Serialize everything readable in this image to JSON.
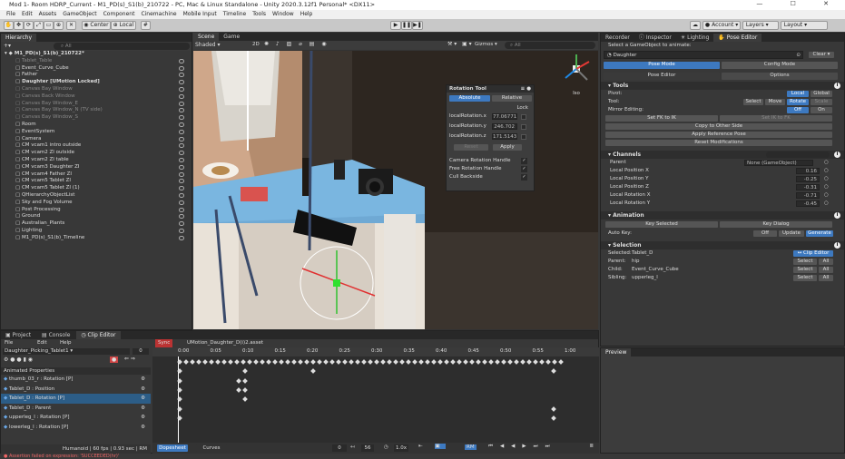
{
  "window": {
    "title": "Mod 1- Room HDRP_Current - M1_PD(s)_S1(b)_210722 - PC, Mac & Linux Standalone - Unity 2020.3.12f1 Personal* <DX11>",
    "controls": "—  ☐  ✕"
  },
  "menu": [
    "File",
    "Edit",
    "Assets",
    "GameObject",
    "Component",
    "Cinemachine",
    "Mobile Input",
    "Timeline",
    "Tools",
    "Window",
    "Help"
  ],
  "toolbar": {
    "pivot": "Center",
    "space": "Local",
    "account": "Account",
    "layers": "Layers",
    "layout": "Layout"
  },
  "hierarchy": {
    "tab": "Hierarchy",
    "search": "All",
    "root": "M1_PD(s)_S1(b)_210722*",
    "items": [
      {
        "label": "Tablet_Table",
        "depth": 1,
        "dim": true
      },
      {
        "label": "Event_Curve_Cube",
        "depth": 1
      },
      {
        "label": "Father",
        "depth": 1
      },
      {
        "label": "Daughter [UMotion Locked]",
        "depth": 1,
        "bold": true
      },
      {
        "label": "Canvas Bay Window",
        "depth": 1,
        "dim": true
      },
      {
        "label": "Canvas Back Window",
        "depth": 1,
        "dim": true
      },
      {
        "label": "Canvas Bay Window_E",
        "depth": 1,
        "dim": true
      },
      {
        "label": "Canvas Bay Window_N  (TV side)",
        "depth": 1,
        "dim": true
      },
      {
        "label": "Canvas Bay Window_S",
        "depth": 1,
        "dim": true
      },
      {
        "label": "Room",
        "depth": 1
      },
      {
        "label": "EventSystem",
        "depth": 1
      },
      {
        "label": "Camera",
        "depth": 1
      },
      {
        "label": "CM vcam1 intro outside",
        "depth": 1
      },
      {
        "label": "CM vcam2 ZI outside",
        "depth": 1
      },
      {
        "label": "CM vcam2 ZI table",
        "depth": 1
      },
      {
        "label": "CM vcam3 Daughter ZI",
        "depth": 1
      },
      {
        "label": "CM vcam4 Father ZI",
        "depth": 1
      },
      {
        "label": "CM vcam5 Tablet ZI",
        "depth": 1
      },
      {
        "label": "CM vcam5 Tablet ZI (1)",
        "depth": 1
      },
      {
        "label": "QHierarchyObjectList",
        "depth": 1
      },
      {
        "label": "Sky and Fog Volume",
        "depth": 1
      },
      {
        "label": "Post Processing",
        "depth": 1
      },
      {
        "label": "Ground",
        "depth": 1
      },
      {
        "label": "Australian_Plants",
        "depth": 1
      },
      {
        "label": "Lighting",
        "depth": 1
      },
      {
        "label": "M1_PD(s)_S1(b)_Timeline",
        "depth": 1
      }
    ]
  },
  "scene": {
    "tabs": [
      "Scene",
      "Game"
    ],
    "shading": "Shaded",
    "mode2d": "2D",
    "gizmos": "Gizmos",
    "search": "All",
    "persp": "Iso",
    "rotation_tool": {
      "title": "Rotation Tool",
      "modes": [
        "Absolute",
        "Relative"
      ],
      "lock": "Lock",
      "fields": [
        {
          "label": "localRotation.x",
          "value": "77.06771"
        },
        {
          "label": "localRotation.y",
          "value": "246.702"
        },
        {
          "label": "localRotation.z",
          "value": "171.5143"
        }
      ],
      "reset": "Reset",
      "apply": "Apply",
      "toggles": [
        "Camera Rotation Handle",
        "Free Rotation Handle",
        "Cull Backside"
      ]
    }
  },
  "right": {
    "tabs": [
      "Recorder",
      "Inspector",
      "Lighting",
      "Pose Editor"
    ],
    "prompt": "Select a GameObject to animate:",
    "object": "Daughter",
    "clear": "Clear",
    "modes": [
      "Pose Mode",
      "Config Mode"
    ],
    "subtabs": [
      "Pose Editor",
      "Options"
    ],
    "tools": {
      "title": "Tools",
      "pivot": "Pivot:",
      "pivot_opts": [
        "Local",
        "Global"
      ],
      "tool": "Tool:",
      "tool_opts": [
        "Select",
        "Move",
        "Rotate",
        "Scale"
      ],
      "mirror": "Mirror Editing:",
      "mirror_opts": [
        "Off",
        "On"
      ],
      "fk_ik": "Set FK to IK",
      "ik_fk": "Set IK to FK",
      "copy": "Copy to Other Side",
      "apply_ref": "Apply Reference Pose",
      "reset_mod": "Reset Modifications"
    },
    "channels": {
      "title": "Channels",
      "rows": [
        {
          "label": "Parent",
          "value": "None (GameObject)"
        },
        {
          "label": "Local Position X",
          "value": "0.16"
        },
        {
          "label": "Local Position Y",
          "value": "-0.25"
        },
        {
          "label": "Local Position Z",
          "value": "-0.31"
        },
        {
          "label": "Local Rotation X",
          "value": "-0.71"
        },
        {
          "label": "Local Rotation Y",
          "value": "-0.45"
        }
      ]
    },
    "animation": {
      "title": "Animation",
      "key_selected": "Key Selected",
      "key_dialog": "Key Dialog",
      "auto_key": "Auto Key:",
      "opts": [
        "Off",
        "Update",
        "Generate"
      ]
    },
    "selection": {
      "title": "Selection",
      "selected": "Selected:",
      "selected_val": "Tablet_D",
      "clip_editor": "↔ Clip Editor",
      "parent": "Parent:",
      "parent_val": "hip",
      "child": "Child:",
      "child_val": "Event_Curve_Cube",
      "sibling": "Sibling:",
      "sibling_val": "upperleg_l",
      "select": "Select",
      "all": "All"
    },
    "preview": "Preview"
  },
  "bottom": {
    "tabs": [
      "Project",
      "Console",
      "Clip Editor"
    ],
    "menus": [
      "File",
      "Edit",
      "Help"
    ],
    "clip": "Daughter_Picking_Tablet1",
    "frame": "0",
    "sync": "Sync",
    "asset": "UMotion_Daughter_D(i)2.asset",
    "ticks": [
      "0:00",
      "0:05",
      "0:10",
      "0:15",
      "0:20",
      "0:25",
      "0:30",
      "0:35",
      "0:40",
      "0:45",
      "0:50",
      "0:55",
      "1:00"
    ],
    "props_title": "Animated Properties",
    "props": [
      {
        "label": "thumb_03_r : Rotation [P]"
      },
      {
        "label": "Tablet_D : Position"
      },
      {
        "label": "Tablet_D : Rotation [P]"
      },
      {
        "label": "Tablet_D : Parent"
      },
      {
        "label": "upperleg_l : Rotation [P]"
      },
      {
        "label": "lowerleg_l : Rotation [P]"
      }
    ],
    "status": "Humanoid | 60 fps | 0.93 sec | RM",
    "view_tabs": [
      "Dopesheet",
      "Curves"
    ],
    "current": "0",
    "frames": "56",
    "speed": "1.0x",
    "rm": "RM"
  },
  "console_error": "Assertion failed on expression: 'SUCCEEDED(hr)'"
}
